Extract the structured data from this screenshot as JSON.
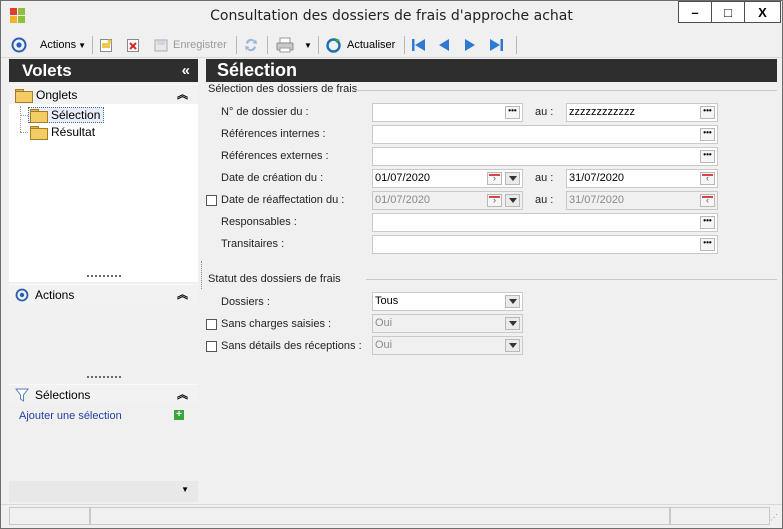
{
  "window": {
    "title": "Consultation des dossiers de frais d'approche achat",
    "controls": [
      "–",
      "□",
      "X"
    ]
  },
  "toolbar": {
    "actions_label": "Actions",
    "save_label": "Enregistrer",
    "refresh_label": "Actualiser"
  },
  "left_panel": {
    "title": "Volets",
    "collapse_glyph": "«",
    "onglets": {
      "label": "Onglets",
      "items": [
        {
          "label": "Sélection"
        },
        {
          "label": "Résultat"
        }
      ]
    },
    "actions": {
      "label": "Actions"
    },
    "selections": {
      "label": "Sélections",
      "add_label": "Ajouter une sélection"
    }
  },
  "main": {
    "title": "Sélection",
    "group1_title": "Sélection des dossiers de frais",
    "group2_title": "Statut des dossiers de frais",
    "au_label": "au :",
    "fields": {
      "dossier_label": "N° de dossier du :",
      "dossier_from": "",
      "dossier_to": "zzzzzzzzzzzz",
      "ref_int_label": "Références internes :",
      "ref_int_value": "",
      "ref_ext_label": "Références externes :",
      "ref_ext_value": "",
      "creation_label": "Date de création du :",
      "creation_from": "01/07/2020",
      "creation_to": "31/07/2020",
      "reaffect_label": "Date de réaffectation du :",
      "reaffect_from": "01/07/2020",
      "reaffect_to": "31/07/2020",
      "responsables_label": "Responsables :",
      "responsables_value": "",
      "transitaires_label": "Transitaires :",
      "transitaires_value": ""
    },
    "status": {
      "dossiers_label": "Dossiers :",
      "dossiers_value": "Tous",
      "sans_charges_label": "Sans charges saisies :",
      "sans_charges_value": "Oui",
      "sans_details_label": "Sans détails des réceptions :",
      "sans_details_value": "Oui"
    }
  },
  "colors": {
    "header_dark": "#2e2e2e",
    "link_blue": "#1f3fa6",
    "window_bg": "#f0f0f0"
  }
}
